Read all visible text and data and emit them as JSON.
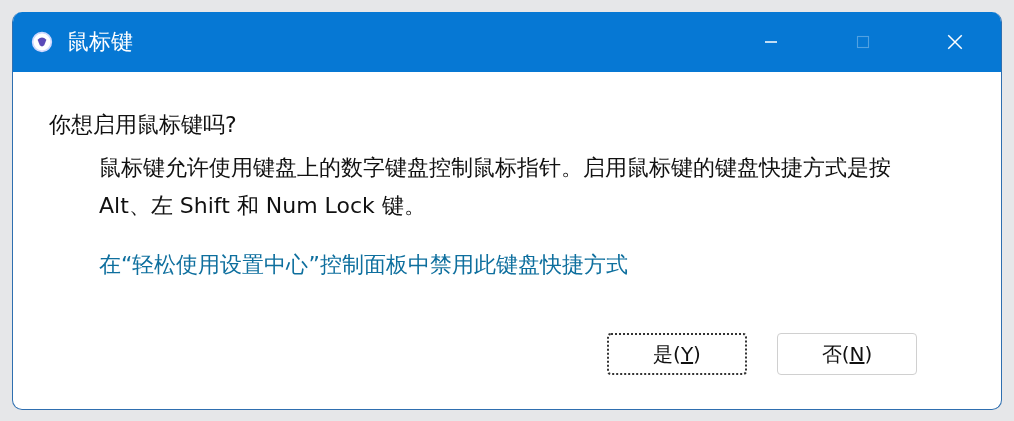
{
  "window": {
    "title": "鼠标键",
    "controls": [
      {
        "kind": "minimize",
        "disabled": false
      },
      {
        "kind": "maximize",
        "disabled": true
      },
      {
        "kind": "close",
        "disabled": false
      }
    ]
  },
  "question": "你想启用鼠标键吗?",
  "description_lines": [
    "鼠标键允许使用键盘上的数字键盘控制鼠标指针。启用鼠标键的键盘快捷方式是按",
    "Alt、左 Shift 和 Num Lock 键。"
  ],
  "link": "在“轻松使用设置中心”控制面板中禁用此键盘快捷方式",
  "buttons": [
    {
      "text": "是(",
      "access_key": "Y",
      "after": ")",
      "focused": true
    },
    {
      "text": "否(",
      "access_key": "N",
      "after": ")",
      "focused": false
    }
  ]
}
